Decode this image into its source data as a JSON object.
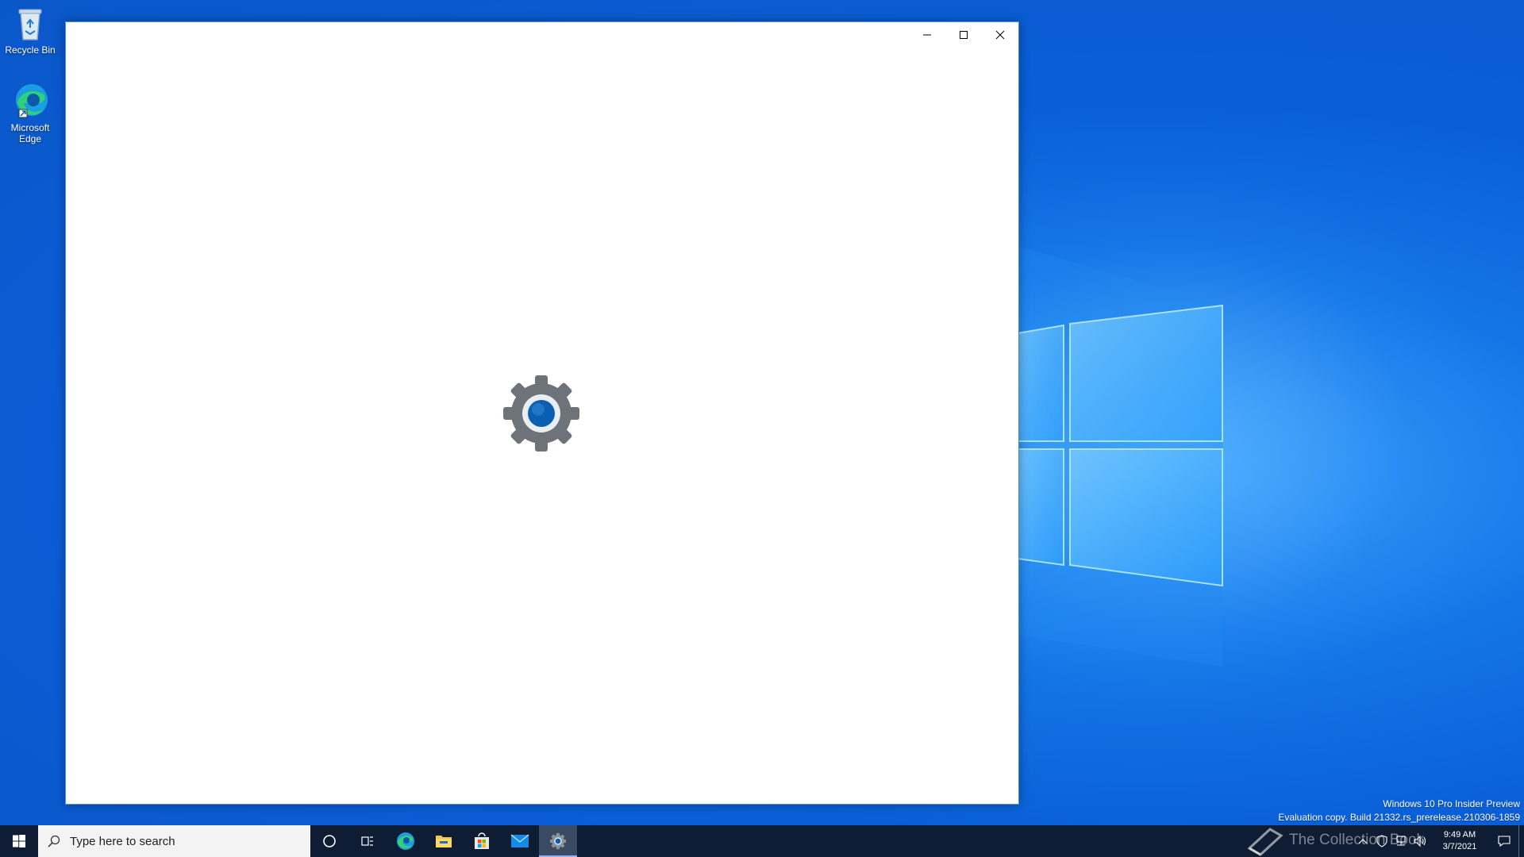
{
  "desktop": {
    "icons": [
      {
        "label": "Recycle Bin",
        "icon": "recycle-bin-icon"
      },
      {
        "label": "Microsoft Edge",
        "icon": "edge-icon"
      }
    ],
    "watermark": {
      "line1": "Windows 10 Pro Insider Preview",
      "line2": "Evaluation copy. Build 21332.rs_prerelease.210306-1859"
    },
    "overlay_text": "The Collection Book"
  },
  "window": {
    "app": "settings",
    "splash_icon": "settings-gear-icon",
    "caption": {
      "minimize": "minimize-icon",
      "maximize": "maximize-icon",
      "close": "close-icon"
    }
  },
  "taskbar": {
    "search_placeholder": "Type here to search",
    "pinned": [
      "cortana-icon",
      "task-view-icon",
      "edge-icon",
      "file-explorer-icon",
      "store-icon",
      "mail-icon",
      "settings-icon"
    ],
    "active": "settings-icon",
    "clock": {
      "time": "9:49 AM",
      "date": "3/7/2021"
    }
  },
  "colors": {
    "accent": "#0078d7",
    "taskbar": "#0f1d34",
    "gear": "#6e7379"
  }
}
